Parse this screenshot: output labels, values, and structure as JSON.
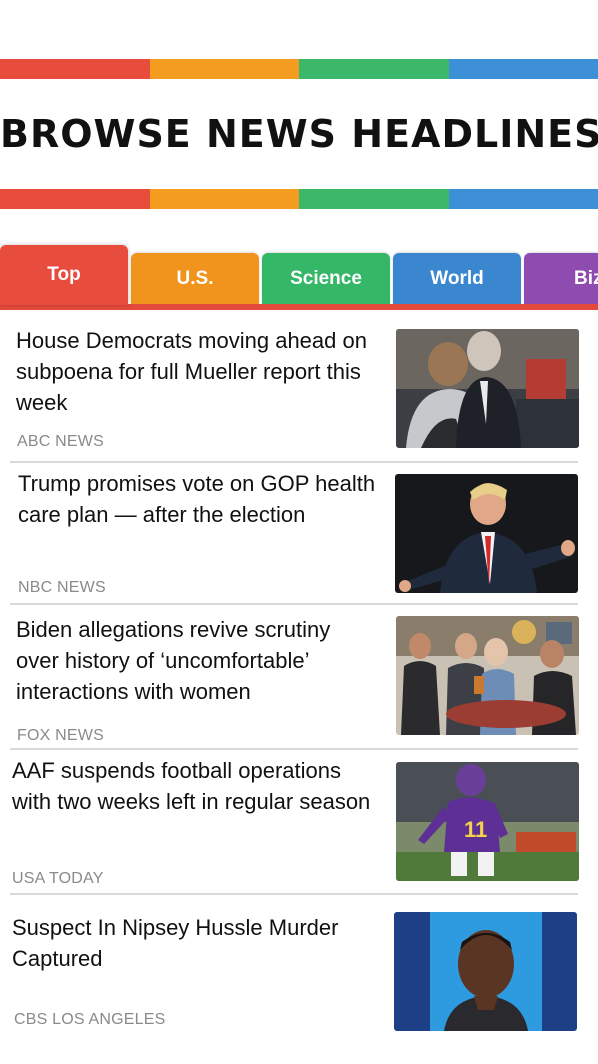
{
  "header": {
    "title": "BROWSE NEWS HEADLINES",
    "stripe_colors": [
      "#e74c3c",
      "#f39c1f",
      "#3cb86a",
      "#3d8fd6"
    ]
  },
  "tabs": [
    {
      "label": "Top",
      "color": "#e74c3c",
      "active": true
    },
    {
      "label": "U.S.",
      "color": "#f0941d"
    },
    {
      "label": "Science",
      "color": "#35b768"
    },
    {
      "label": "World",
      "color": "#3a87d0"
    },
    {
      "label": "Biz",
      "color": "#8e4bb0"
    }
  ],
  "articles": [
    {
      "headline": "House Democrats moving ahead on subpoena for full Mueller report this week",
      "source": "ABC NEWS",
      "image": "two-men-outdoors-photo"
    },
    {
      "headline": "Trump promises vote on GOP health care plan — after the election",
      "source": "NBC NEWS",
      "image": "man-speaking-red-tie-photo"
    },
    {
      "headline": "Biden allegations revive scrutiny over history of ‘uncomfortable’ interactions with women",
      "source": "FOX NEWS",
      "image": "diner-group-photo"
    },
    {
      "headline": "AAF suspends football operations with two weeks left in regular season",
      "source": "USA TODAY",
      "image": "football-player-photo"
    },
    {
      "headline": "Suspect In Nipsey Hussle Murder Captured",
      "source": "CBS LOS ANGELES",
      "image": "suspect-portrait-photo"
    }
  ]
}
